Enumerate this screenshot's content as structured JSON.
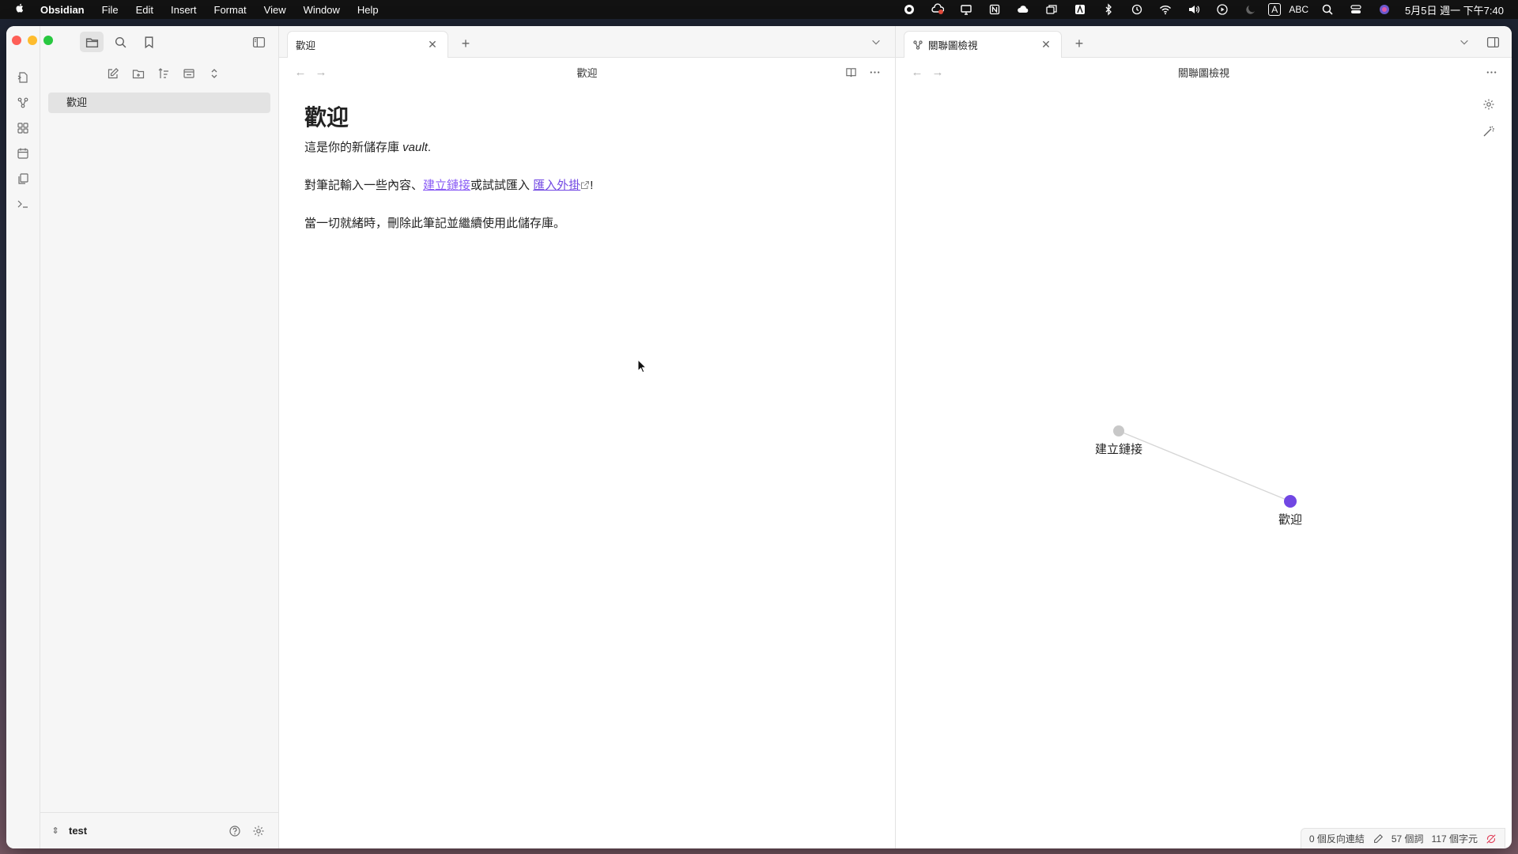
{
  "menubar": {
    "apple_icon": "apple-logo",
    "app_name": "Obsidian",
    "items": [
      "File",
      "Edit",
      "Insert",
      "Format",
      "View",
      "Window",
      "Help"
    ],
    "input_method_a": "A",
    "input_method_abc": "ABC",
    "clock": "5月5日 週一 下午7:40"
  },
  "sidebar": {
    "files": [
      "歡迎"
    ],
    "vault_name": "test"
  },
  "left_pane": {
    "tab_title": "歡迎",
    "view_title": "歡迎",
    "note": {
      "heading": "歡迎",
      "line1_prefix": "這是你的新儲存庫 ",
      "line1_italic": "vault",
      "line1_suffix": ".",
      "line2_prefix": "對筆記輸入一些內容、",
      "line2_link": "建立鏈接",
      "line2_middle": "或試試匯入 ",
      "line2_ext_link": "匯入外掛",
      "line2_suffix": "!",
      "line3": "當一切就緒時，刪除此筆記並繼續使用此儲存庫。"
    }
  },
  "right_pane": {
    "tab_title": "關聯圖檢視",
    "view_title": "關聯圖檢視",
    "graph": {
      "nodes": [
        {
          "label": "建立鏈接",
          "color": "#c8c8c8"
        },
        {
          "label": "歡迎",
          "color": "#7147e3"
        }
      ],
      "edge_color": "#d6d6d6"
    }
  },
  "statusbar": {
    "backlinks": "0 個反向連結",
    "words": "57 個詞",
    "chars": "117 個字元"
  },
  "colors": {
    "accent": "#7147e3",
    "link": "#8a5cf5"
  }
}
